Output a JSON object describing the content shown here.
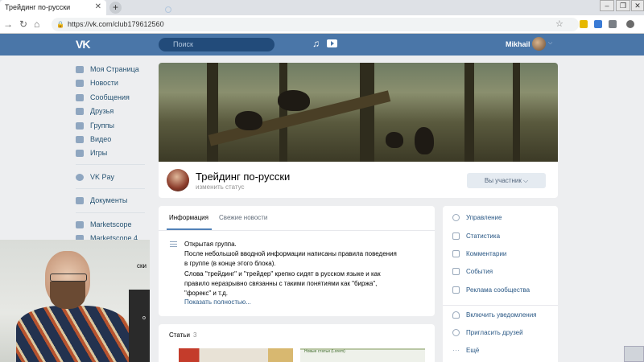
{
  "browser": {
    "tab_title": "Трейдинг по-русски",
    "tab_close": "✕",
    "new_tab": "+",
    "url": "https://vk.com/club179612560"
  },
  "vk": {
    "search_placeholder": "Поиск",
    "username": "Mikhail"
  },
  "menu": [
    {
      "label": "Моя Страница"
    },
    {
      "label": "Новости"
    },
    {
      "label": "Сообщения"
    },
    {
      "label": "Друзья"
    },
    {
      "label": "Группы"
    },
    {
      "label": "Видео"
    },
    {
      "label": "Игры"
    },
    {
      "label": "VK Pay"
    },
    {
      "label": "Документы"
    },
    {
      "label": "Marketscope"
    },
    {
      "label": "Marketscope 4"
    }
  ],
  "group": {
    "name": "Трейдинг по-русски",
    "status": "изменить статус",
    "member_button": "Вы участник ⌵"
  },
  "info": {
    "tabs": [
      "Информация",
      "Свежие новости"
    ],
    "lines": [
      "Открытая группа.",
      "После небольшой вводной информации написаны правила поведения",
      "в группе (в конце этого блока).",
      "Слова \"трейдинг\" и \"трейдер\" крепко сидят в русском языке и как",
      "правило неразрывно связанны с такими понятиями как \"биржа\",",
      "\"форекс\" и т.д."
    ],
    "show_more": "Показать полностью..."
  },
  "articles": {
    "title": "Статьи",
    "count": "3",
    "card2_text": "Новые статьи (Lorem)"
  },
  "right_menu": [
    "Управление",
    "Статистика",
    "Комментарии",
    "События",
    "Реклама сообщества",
    "Включить уведомления",
    "Пригласить друзей",
    "Ещё"
  ],
  "webcam": {
    "cut_text": "ски",
    "cut_text2": "о"
  }
}
